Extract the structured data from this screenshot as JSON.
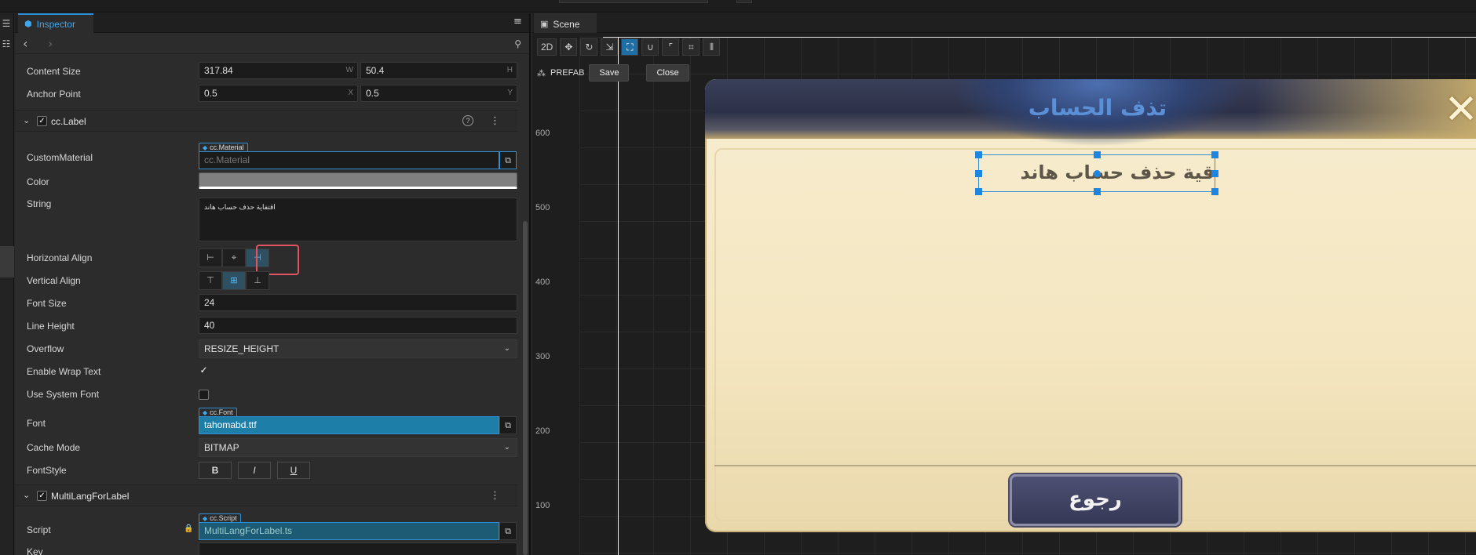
{
  "inspector": {
    "tab_label": "Inspector",
    "content_size": {
      "label": "Content Size",
      "w": "317.84",
      "w_suffix": "W",
      "h": "50.4",
      "h_suffix": "H"
    },
    "anchor_point": {
      "label": "Anchor Point",
      "x": "0.5",
      "x_suffix": "X",
      "y": "0.5",
      "y_suffix": "Y"
    },
    "label_section": {
      "title": "cc.Label",
      "enabled": true
    },
    "custom_material": {
      "label": "CustomMaterial",
      "tag": "cc.Material",
      "placeholder": "cc.Material"
    },
    "color": {
      "label": "Color",
      "value": "#808080"
    },
    "string": {
      "label": "String",
      "value": "اقتفاية حذف حساب هاند"
    },
    "horizontal_align": {
      "label": "Horizontal Align",
      "selected": "right"
    },
    "vertical_align": {
      "label": "Vertical Align",
      "selected": "center"
    },
    "font_size": {
      "label": "Font Size",
      "value": "24"
    },
    "line_height": {
      "label": "Line Height",
      "value": "40"
    },
    "overflow": {
      "label": "Overflow",
      "value": "RESIZE_HEIGHT"
    },
    "enable_wrap_text": {
      "label": "Enable Wrap Text",
      "checked": true
    },
    "use_system_font": {
      "label": "Use System Font",
      "checked": false
    },
    "font": {
      "label": "Font",
      "tag": "cc.Font",
      "value": "tahomabd.ttf"
    },
    "cache_mode": {
      "label": "Cache Mode",
      "value": "BITMAP"
    },
    "font_style": {
      "label": "FontStyle",
      "bold": "B",
      "italic": "I",
      "underline": "U"
    },
    "multilang_section": {
      "title": "MultiLangForLabel",
      "enabled": true
    },
    "script": {
      "label": "Script",
      "tag": "cc.Script",
      "value": "MultiLangForLabel.ts"
    },
    "key": {
      "label": "Key",
      "value": ""
    }
  },
  "scene": {
    "tab_label": "Scene",
    "toolbar": {
      "mode_2d": "2D"
    },
    "prefab": {
      "label": "PREFAB",
      "save": "Save",
      "close": "Close"
    },
    "ruler_ticks": [
      "600",
      "500",
      "400",
      "300",
      "200",
      "100"
    ],
    "dialog": {
      "title": "تذف الحساب",
      "label_text": "قية حذف حساب هاند",
      "back_button": "رجوع"
    }
  },
  "colors": {
    "accent": "#2a8fd6",
    "highlight": "#e35561",
    "selection": "#1e86e0"
  }
}
